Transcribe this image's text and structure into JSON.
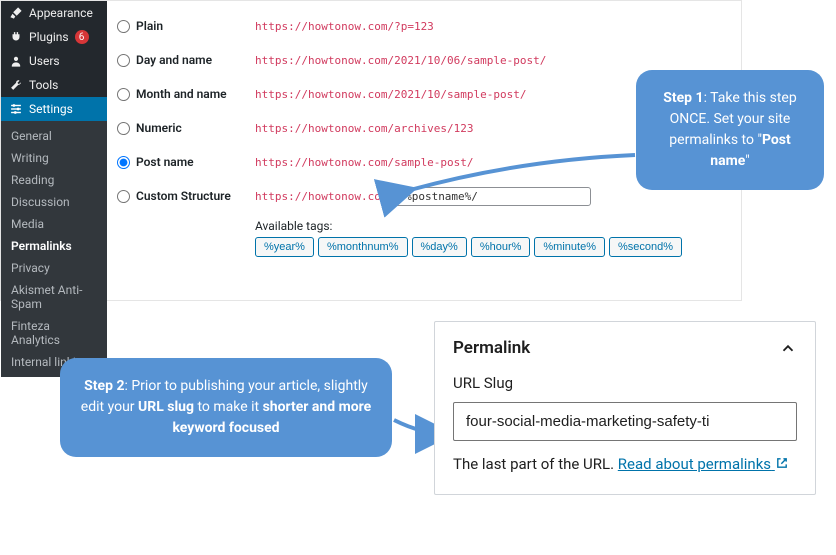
{
  "sidebar": {
    "items": [
      {
        "label": "Appearance",
        "icon": "brush"
      },
      {
        "label": "Plugins",
        "icon": "plug",
        "badge": "6"
      },
      {
        "label": "Users",
        "icon": "user"
      },
      {
        "label": "Tools",
        "icon": "wrench"
      },
      {
        "label": "Settings",
        "icon": "sliders",
        "active": true
      }
    ],
    "submenu": [
      {
        "label": "General"
      },
      {
        "label": "Writing"
      },
      {
        "label": "Reading"
      },
      {
        "label": "Discussion"
      },
      {
        "label": "Media"
      },
      {
        "label": "Permalinks",
        "current": true
      },
      {
        "label": "Privacy"
      },
      {
        "label": "Akismet Anti-Spam"
      },
      {
        "label": "Finteza Analytics"
      },
      {
        "label": "Internal linking"
      }
    ]
  },
  "permalink_settings": {
    "options": [
      {
        "label": "Plain",
        "sample": "https://howtonow.com/?p=123"
      },
      {
        "label": "Day and name",
        "sample": "https://howtonow.com/2021/10/06/sample-post/"
      },
      {
        "label": "Month and name",
        "sample": "https://howtonow.com/2021/10/sample-post/"
      },
      {
        "label": "Numeric",
        "sample": "https://howtonow.com/archives/123"
      },
      {
        "label": "Post name",
        "sample": "https://howtonow.com/sample-post/",
        "checked": true
      },
      {
        "label": "Custom Structure",
        "base": "https://howtonow.com",
        "value": "/%postname%/"
      }
    ],
    "tags_label": "Available tags:",
    "tags": [
      "%year%",
      "%monthnum%",
      "%day%",
      "%hour%",
      "%minute%",
      "%second%"
    ]
  },
  "callouts": {
    "step1": {
      "strong": "Step 1",
      "rest": ": Take this step ONCE. Set your site permalinks to \"",
      "strong2": "Post name",
      "end": "\""
    },
    "step2": {
      "strong": "Step 2",
      "mid1": ": Prior to publishing your article, slightly edit your ",
      "strong2": "URL slug",
      "mid2": " to make it ",
      "strong3": "shorter and more keyword focused"
    }
  },
  "perma_panel": {
    "title": "Permalink",
    "label": "URL Slug",
    "value": "four-social-media-marketing-safety-ti",
    "help_pre": "The last part of the URL. ",
    "link_text": "Read about permalinks"
  }
}
